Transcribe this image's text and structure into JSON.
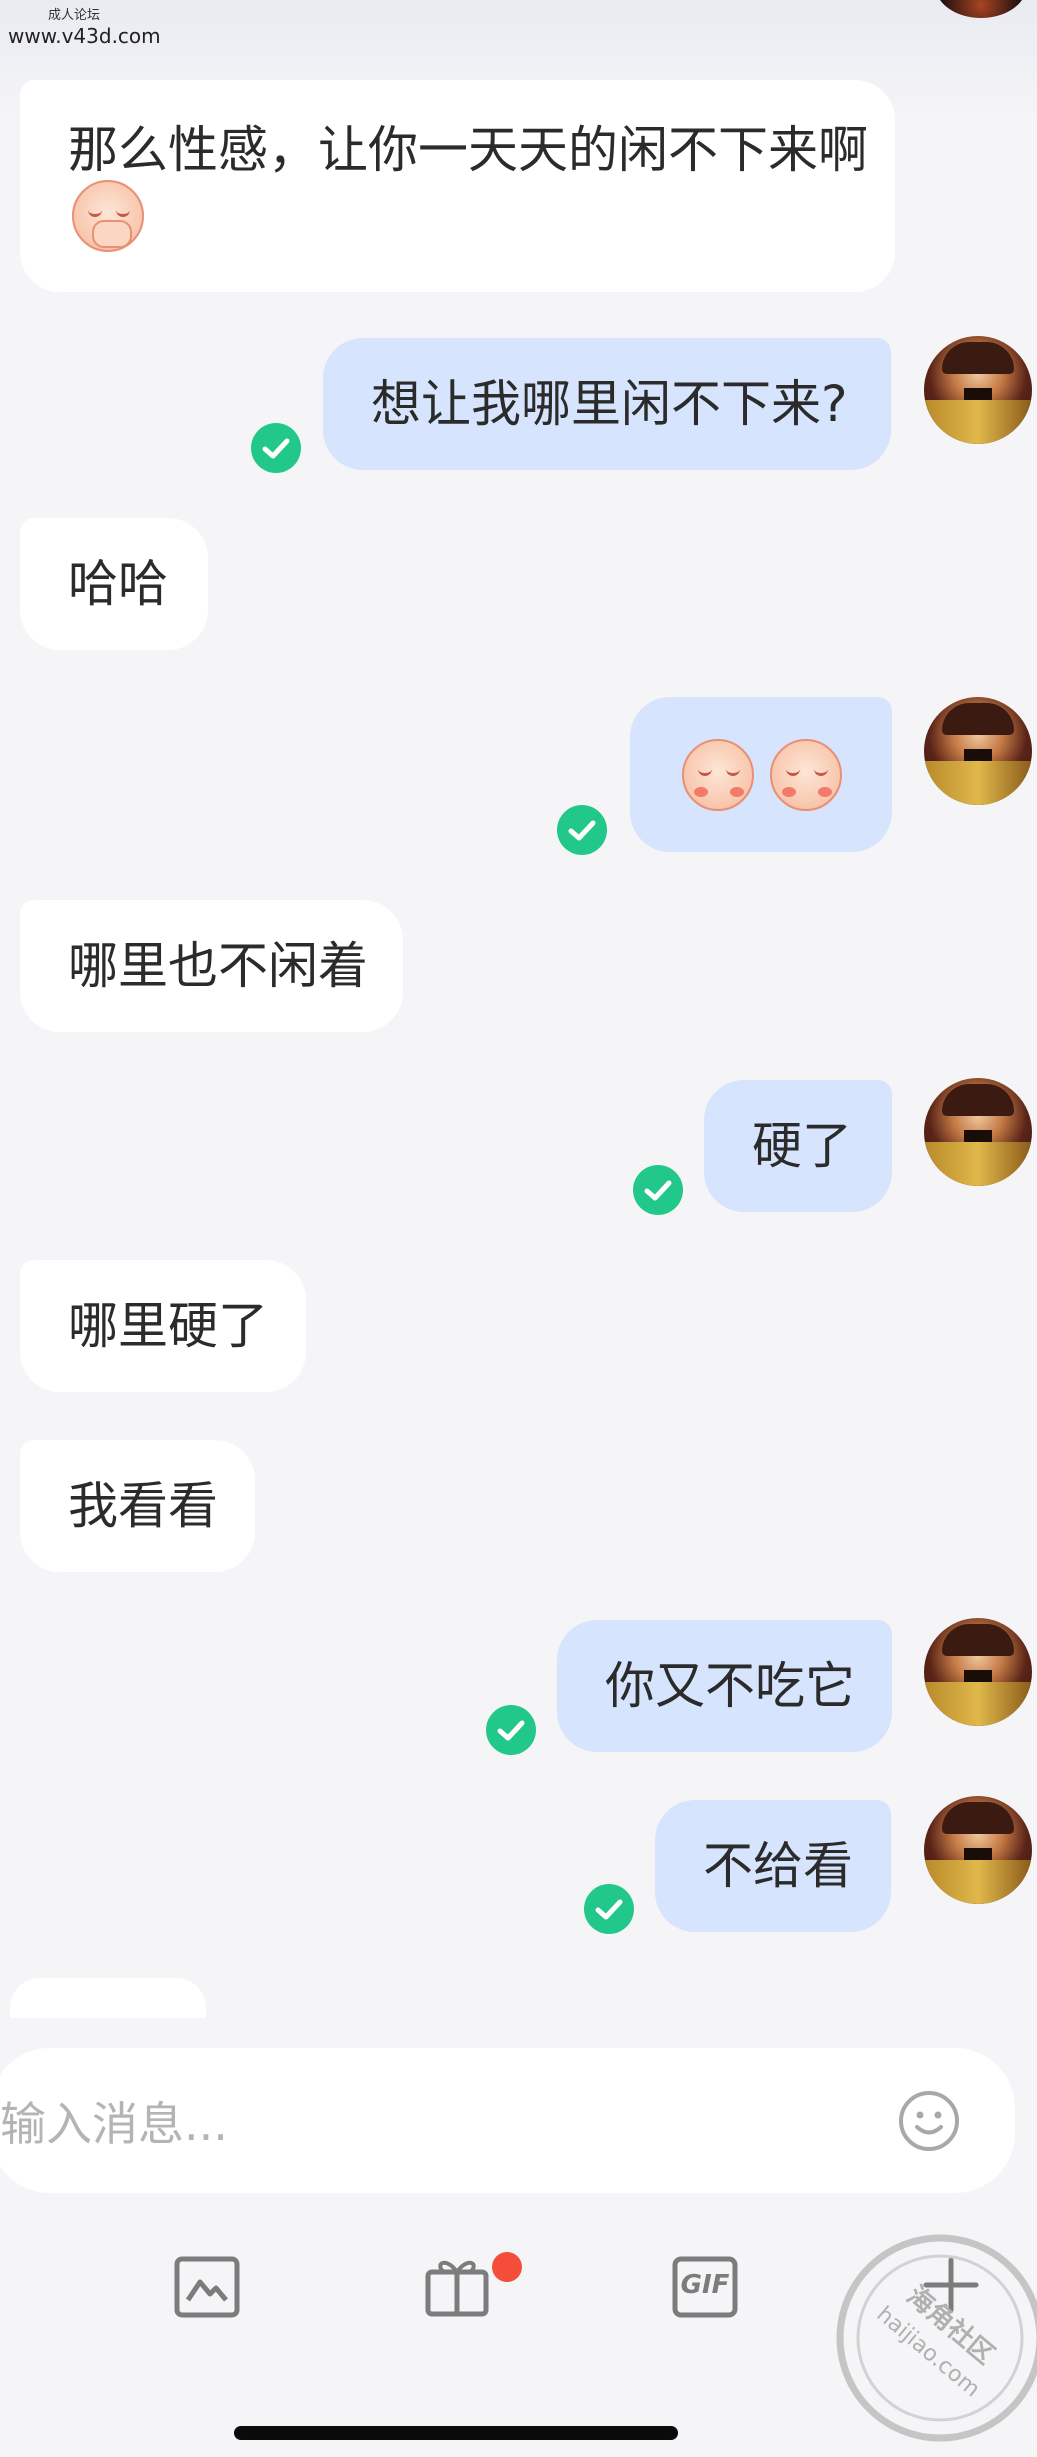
{
  "watermark": {
    "small_text": "成人论坛",
    "site": "www.v43d.com",
    "stamp_text": "海角社区",
    "stamp_url": "haijiao.com"
  },
  "messages": [
    {
      "side": "incoming",
      "text": "那么性感，让你一天天的闲不下来啊",
      "emoji": "covering-mouth-emoji"
    },
    {
      "side": "outgoing",
      "text": "想让我哪里闲不下来?",
      "status": "read"
    },
    {
      "side": "incoming",
      "text": "哈哈"
    },
    {
      "side": "outgoing",
      "text": "",
      "emoji": "blushing-emoji x2",
      "status": "read"
    },
    {
      "side": "incoming",
      "text": "哪里也不闲着"
    },
    {
      "side": "outgoing",
      "text": "硬了",
      "status": "read"
    },
    {
      "side": "incoming",
      "text": "哪里硬了"
    },
    {
      "side": "incoming",
      "text": "我看看"
    },
    {
      "side": "outgoing",
      "text": "你又不吃它",
      "status": "read"
    },
    {
      "side": "outgoing",
      "text": "不给看",
      "status": "read"
    }
  ],
  "composer": {
    "placeholder": "输入消息...",
    "emoji_icon": "smile-icon"
  },
  "toolbar": {
    "image_icon": "image-icon",
    "gift_icon": "gift-icon",
    "gif_label": "GIF",
    "plus_icon": "plus-icon"
  },
  "colors": {
    "incoming_bubble": "#ffffff",
    "outgoing_bubble": "#d6e4fd",
    "read_check": "#22c88a",
    "badge": "#f44d3a"
  }
}
